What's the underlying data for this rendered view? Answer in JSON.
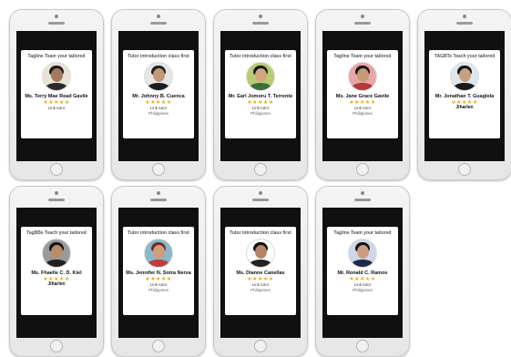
{
  "phones": [
    {
      "title": "Tagline Team your tailored",
      "name": "Ms. Terry Mae Read Gavile",
      "stars": "★★★★★",
      "role": "Link tutor",
      "place": "",
      "colors": {
        "bg": "#e9e2d6",
        "skin": "#a47a5a",
        "hair": "#1c1c1c",
        "shirt": "#2a2a2a"
      }
    },
    {
      "title": "Tutor introduction class first",
      "name": "Mr. Johnny B. Cuenca",
      "stars": "★★★★★",
      "role": "Link tutor",
      "place": "Philippines",
      "colors": {
        "bg": "#e6e6e6",
        "skin": "#c49a78",
        "hair": "#222222",
        "shirt": "#1d1d1d"
      }
    },
    {
      "title": "Tutor introduction class first",
      "name": "Mr. Earl Jomoru T. Terrente",
      "stars": "★★★★★",
      "role": "Link tutor",
      "place": "Philippines",
      "colors": {
        "bg": "#b7cc73",
        "skin": "#d4a680",
        "hair": "#1a1a1a",
        "shirt": "#3b6e3a"
      }
    },
    {
      "title": "Tagline Team your tailored",
      "name": "Ms. Jane Grace Gavile",
      "stars": "★★★★★",
      "role": "Link tutor",
      "place": "Philippines",
      "colors": {
        "bg": "#e9a6a6",
        "skin": "#c79a76",
        "hair": "#151515",
        "shirt": "#b33b3b"
      }
    },
    {
      "title": "TAGBTe Teach your tailored",
      "name": "Mr. Jonathan T. Guaglela",
      "stars": "★★★★★",
      "role": "",
      "place": "Jiharlen",
      "colors": {
        "bg": "#dfe6ec",
        "skin": "#c9a080",
        "hair": "#111111",
        "shirt": "#1a1a1a"
      }
    },
    {
      "title": "TagBBe Teach your tailored",
      "name": "Ms. Fhaelle C. D. Kiel",
      "stars": "★★★★★",
      "role": "",
      "place": "Jiharlen",
      "colors": {
        "bg": "#9a9a9a",
        "skin": "#b98c68",
        "hair": "#141414",
        "shirt": "#202020"
      }
    },
    {
      "title": "Tutor introduction class first",
      "name": "Ms. Jennifer N. Sotra Nerva",
      "stars": "★★★★★",
      "role": "Link tutor",
      "place": "Philippines",
      "colors": {
        "bg": "#87b9c9",
        "skin": "#d19c7c",
        "hair": "#7a2a2a",
        "shirt": "#c03b3b"
      }
    },
    {
      "title": "Tutor introduction class first",
      "name": "Ms. Dianne Canellas",
      "stars": "★★★★★",
      "role": "Link tutor",
      "place": "Philippines",
      "colors": {
        "bg": "#ffffff",
        "skin": "#b58566",
        "hair": "#111111",
        "shirt": "#222222"
      }
    },
    {
      "title": "Tagline Team your tailored",
      "name": "Mr. Ronald C. Ramos",
      "stars": "★★★★★",
      "role": "Link tutor",
      "place": "Philippines",
      "colors": {
        "bg": "#cfd6e6",
        "skin": "#c99e80",
        "hair": "#151515",
        "shirt": "#1e2a4a"
      }
    }
  ]
}
